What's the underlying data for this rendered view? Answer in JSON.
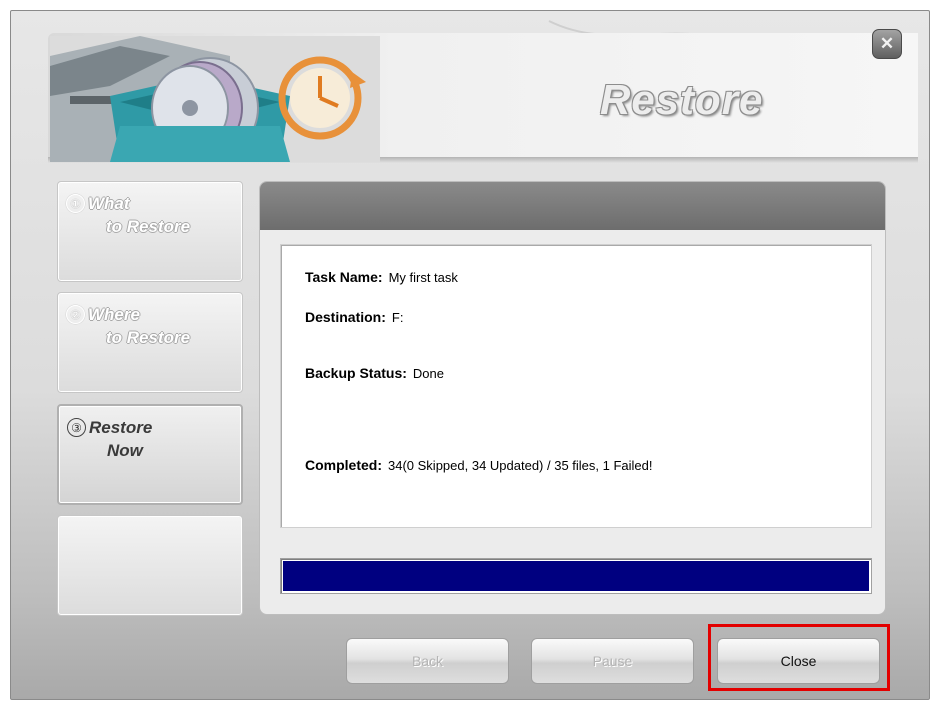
{
  "window": {
    "title": "Restore"
  },
  "steps": [
    {
      "number": "①",
      "line1": "What",
      "line2": "to Restore",
      "active": false
    },
    {
      "number": "②",
      "line1": "Where",
      "line2": "to Restore",
      "active": false
    },
    {
      "number": "③",
      "line1": "Restore",
      "line2": "Now",
      "active": true
    }
  ],
  "details": {
    "task_name_label": "Task Name:",
    "task_name_value": "My first task",
    "destination_label": "Destination:",
    "destination_value": "F:",
    "backup_status_label": "Backup Status:",
    "backup_status_value": "Done",
    "completed_label": "Completed:",
    "completed_value": "34(0 Skipped, 34 Updated) / 35 files, 1 Failed!"
  },
  "progress": {
    "value": 1.0
  },
  "buttons": {
    "back": "Back",
    "pause": "Pause",
    "close": "Close"
  },
  "colors": {
    "progress_fill": "#000080",
    "highlight": "#e30000",
    "panel_header": "#7a7a7a"
  },
  "icons": {
    "window_close": "close-icon",
    "banner_art": "backup-disc-clock-icon"
  }
}
